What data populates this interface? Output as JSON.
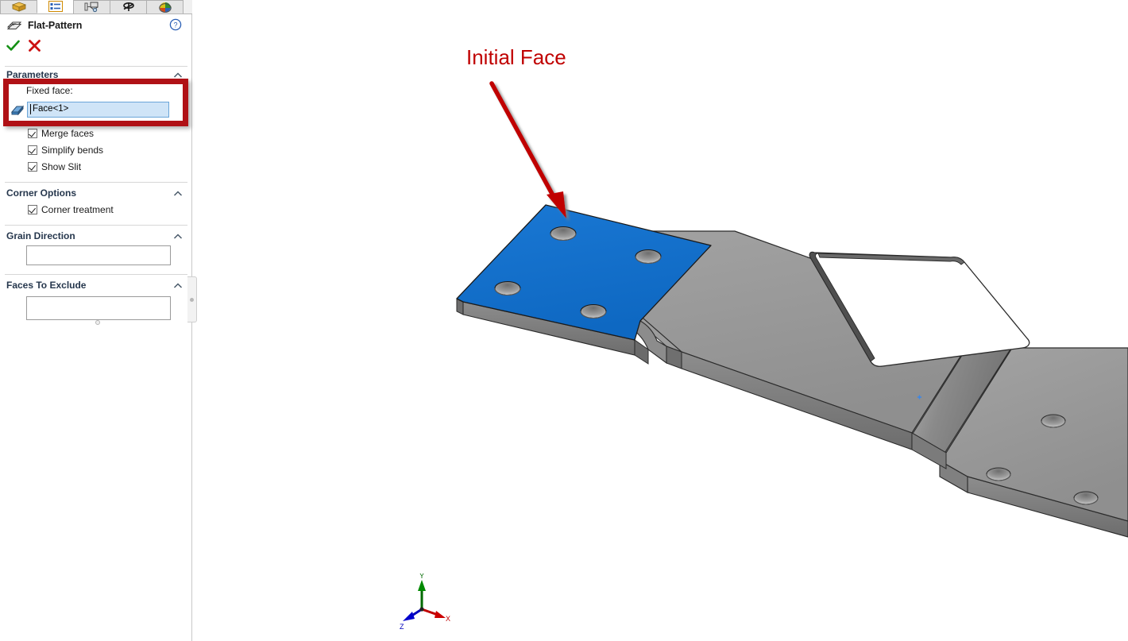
{
  "property_manager": {
    "tabs": [
      {
        "name": "feature-manager-design-tree",
        "icon": "feature-tree-icon",
        "active": false
      },
      {
        "name": "property-manager",
        "icon": "property-list-icon",
        "active": true
      },
      {
        "name": "configuration-manager",
        "icon": "configuration-icon",
        "active": false
      },
      {
        "name": "dimxpert-manager",
        "icon": "dimxpert-icon",
        "active": false
      },
      {
        "name": "display-manager",
        "icon": "display-manager-icon",
        "active": false
      }
    ],
    "title": "Flat-Pattern",
    "title_icon": "flat-pattern-icon",
    "help_icon": "help-question-icon",
    "ok_label": "OK",
    "cancel_label": "Cancel",
    "groups": [
      {
        "id": "parameters",
        "label": "Parameters",
        "fixed_face_label": "Fixed face:",
        "fixed_face_value": "Face<1>",
        "fixed_face_icon": "face-selection-icon",
        "checkboxes": [
          {
            "label": "Merge faces",
            "checked": true
          },
          {
            "label": "Simplify bends",
            "checked": true
          },
          {
            "label": "Show Slit",
            "checked": true
          }
        ]
      },
      {
        "id": "corner-options",
        "label": "Corner Options",
        "checkboxes": [
          {
            "label": "Corner treatment",
            "checked": true
          }
        ]
      },
      {
        "id": "grain-direction",
        "label": "Grain Direction",
        "value": ""
      },
      {
        "id": "faces-to-exclude",
        "label": "Faces To Exclude",
        "value": ""
      }
    ]
  },
  "annotation": {
    "callout_text": "Initial Face",
    "callout_color": "#c00000",
    "highlight_rect_color": "#b01116"
  },
  "graphics": {
    "selected_face_color": "#1070ce",
    "body_color": "#969696",
    "background": "#ffffff",
    "triad": {
      "x_label": "X",
      "y_label": "Y",
      "z_label": "Z",
      "x_color": "#cc0000",
      "y_color": "#007700",
      "z_color": "#0000cc"
    }
  }
}
